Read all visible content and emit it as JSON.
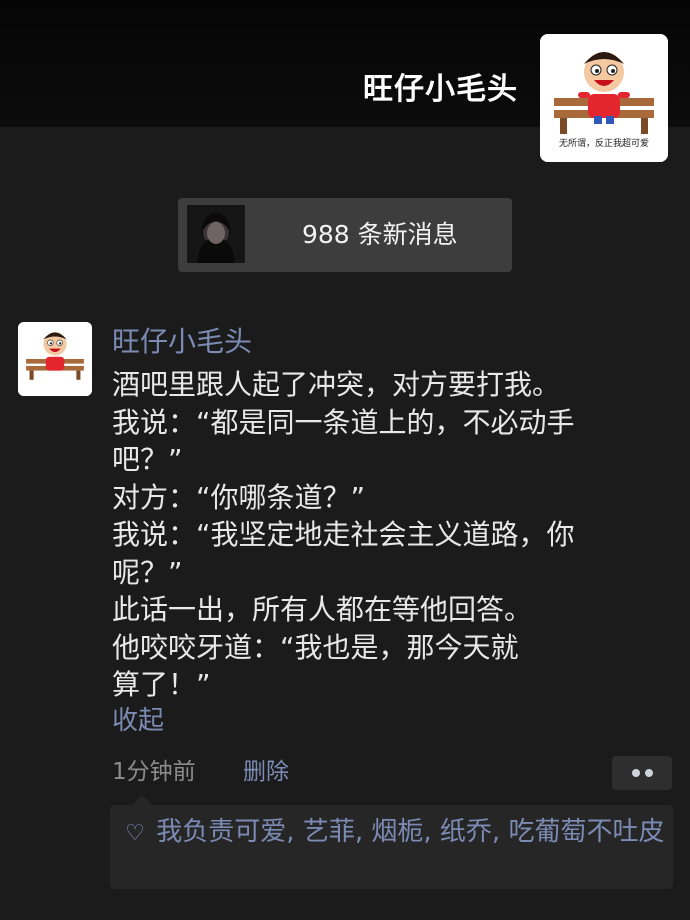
{
  "cover": {
    "name": "旺仔小毛头"
  },
  "avatar": {
    "caption": "无所谓，反正我超可爱"
  },
  "notice": {
    "text": "988 条新消息"
  },
  "post": {
    "author": "旺仔小毛头",
    "lines": [
      "酒吧里跟人起了冲突，对方要打我。",
      "我说：“都是同一条道上的，不必动手",
      "吧？”",
      "对方：“你哪条道？”",
      "我说：“我坚定地走社会主义道路，你",
      "呢？”",
      "此话一出，所有人都在等他回答。",
      "他咬咬牙道：“我也是，那今天就",
      "算了！”"
    ],
    "collapse_label": "收起",
    "time": "1分钟前",
    "delete_label": "删除"
  },
  "likes": {
    "names": [
      "我负责可爱",
      "艺菲",
      "烟栀",
      "纸乔",
      "吃葡萄不吐皮"
    ],
    "separator": ","
  },
  "icons": {
    "like": "heart-outline-icon",
    "more": "more-dots-icon"
  },
  "colors": {
    "background": "#1b1b1b",
    "link": "#7b8bb4",
    "text": "#e8e8e8",
    "notice_bg": "#3d3d3d"
  }
}
